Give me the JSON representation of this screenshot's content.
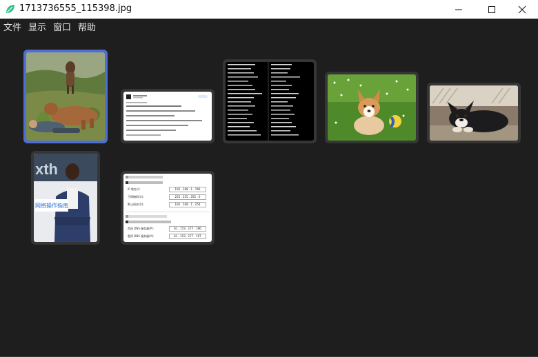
{
  "window": {
    "title": "1713736555_115398.jpg"
  },
  "menu": {
    "items": [
      "文件",
      "显示",
      "窗口",
      "帮助"
    ]
  },
  "thumbnails": [
    {
      "name": "thumb-cattle",
      "selected": true
    },
    {
      "name": "thumb-document",
      "selected": false
    },
    {
      "name": "thumb-vocab-list",
      "selected": false
    },
    {
      "name": "thumb-corgi-puppy",
      "selected": false
    },
    {
      "name": "thumb-black-puppy",
      "selected": false
    },
    {
      "name": "thumb-man-portrait",
      "selected": false,
      "caption": "网络操作指南"
    },
    {
      "name": "thumb-ip-settings",
      "selected": false,
      "ip_rows": [
        {
          "label": "IP 地址(I):",
          "value": "192 . 168 . 1 . 166"
        },
        {
          "label": "子网掩码(U):",
          "value": "255 . 255 . 255 . 0"
        },
        {
          "label": "默认网关(D):",
          "value": "192 . 168 . 1 . 254"
        }
      ],
      "dns_rows": [
        {
          "label": "首选 DNS 服务器(P):",
          "value": "61 . 153 . 177 . 196"
        },
        {
          "label": "备用 DNS 服务器(A):",
          "value": "61 . 153 . 177 . 197"
        }
      ]
    }
  ],
  "colors": {
    "background": "#1e1e1e",
    "selection": "#4d6ed6",
    "thumb_frame": "#363636"
  }
}
